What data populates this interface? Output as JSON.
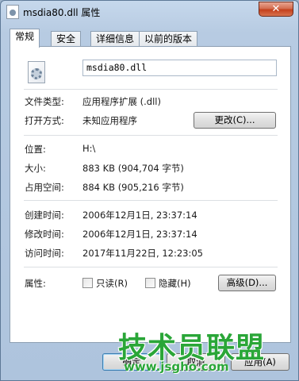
{
  "window": {
    "title": "msdia80.dll 属性",
    "close_label": "✕"
  },
  "tabs": [
    {
      "label": "常规",
      "active": true
    },
    {
      "label": "安全",
      "active": false
    },
    {
      "label": "详细信息",
      "active": false
    },
    {
      "label": "以前的版本",
      "active": false
    }
  ],
  "general": {
    "file_name": "msdia80.dll",
    "file_icon": "dll-gear-icon",
    "file_type_label": "文件类型:",
    "file_type_value": "应用程序扩展 (.dll)",
    "opens_with_label": "打开方式:",
    "opens_with_value": "未知应用程序",
    "change_button": "更改(C)...",
    "location_label": "位置:",
    "location_value": "H:\\",
    "size_label": "大小:",
    "size_value": "883 KB (904,704 字节)",
    "size_on_disk_label": "占用空间:",
    "size_on_disk_value": "884 KB (905,216 字节)",
    "created_label": "创建时间:",
    "created_value": "2006年12月1日, 23:37:14",
    "modified_label": "修改时间:",
    "modified_value": "2006年12月1日, 23:37:14",
    "accessed_label": "访问时间:",
    "accessed_value": "2017年11月22日, 12:23:05",
    "attributes_label": "属性:",
    "readonly_label": "只读(R)",
    "hidden_label": "隐藏(H)",
    "advanced_button": "高级(D)..."
  },
  "footer": {
    "ok_button": "确定",
    "cancel_button": "取消",
    "apply_button": "应用(A)"
  },
  "watermark": {
    "text": "技术员联盟",
    "url": "www.jsgho.com"
  }
}
